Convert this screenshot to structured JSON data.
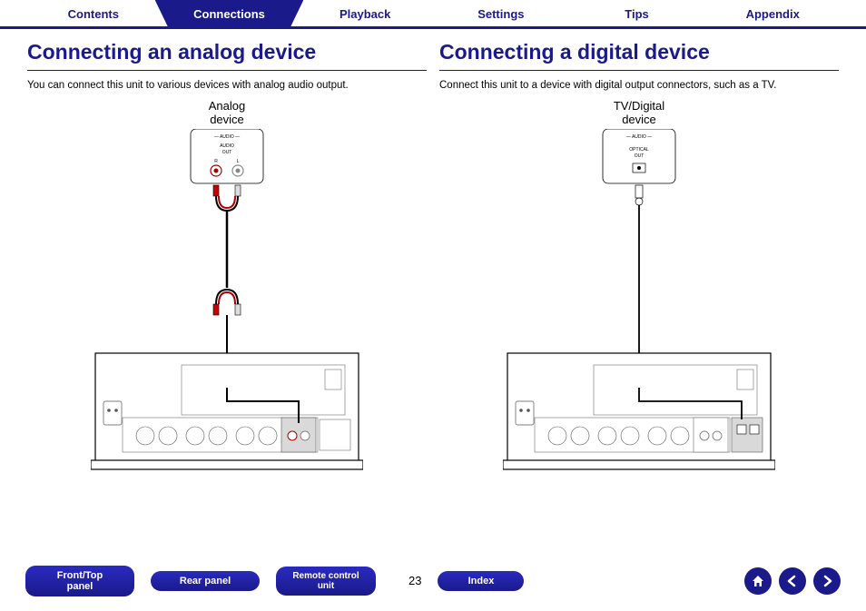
{
  "tabs": [
    "Contents",
    "Connections",
    "Playback",
    "Settings",
    "Tips",
    "Appendix"
  ],
  "activeTab": 1,
  "left": {
    "title": "Connecting an analog device",
    "desc": "You can connect this unit to various devices with analog audio output.",
    "deviceLabel1": "Analog",
    "deviceLabel2": "device",
    "portGroup": "AUDIO",
    "portLabel1": "AUDIO",
    "portLabel2": "OUT",
    "rLabel": "R",
    "lLabel": "L"
  },
  "right": {
    "title": "Connecting a digital device",
    "desc": "Connect this unit to a device with digital output connectors, such as a TV.",
    "deviceLabel1": "TV/Digital",
    "deviceLabel2": "device",
    "portGroup": "AUDIO",
    "portLabel1": "OPTICAL",
    "portLabel2": "OUT"
  },
  "bottomButtons": {
    "frontTop1": "Front/Top",
    "frontTop2": "panel",
    "rear": "Rear panel",
    "remote1": "Remote control",
    "remote2": "unit",
    "index": "Index"
  },
  "pageNumber": "23"
}
